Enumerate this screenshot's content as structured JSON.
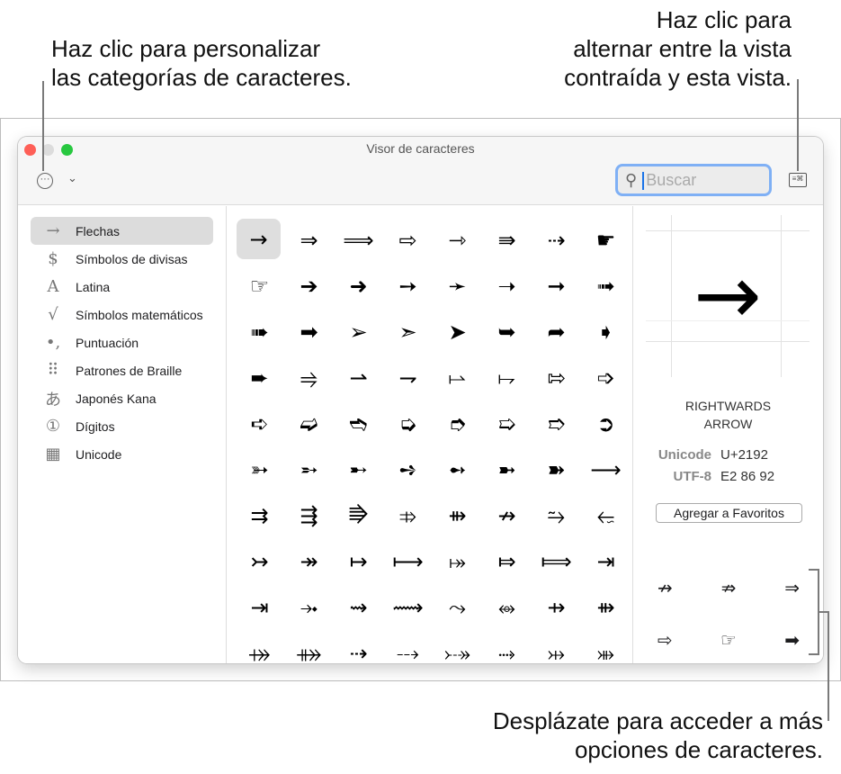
{
  "callouts": {
    "top_left": [
      "Haz clic para personalizar",
      "las categorías de caracteres."
    ],
    "top_right": [
      "Haz clic para",
      "alternar entre la vista",
      "contraída y esta vista."
    ],
    "bottom": [
      "Desplázate para acceder a más",
      "opciones de caracteres."
    ]
  },
  "window": {
    "title": "Visor de caracteres",
    "search_placeholder": "Buscar"
  },
  "sidebar": {
    "items": [
      {
        "icon": "→",
        "label": "Flechas"
      },
      {
        "icon": "$",
        "label": "Símbolos de divisas"
      },
      {
        "icon": "A",
        "label": "Latina"
      },
      {
        "icon": "√",
        "label": "Símbolos matemáticos"
      },
      {
        "icon": "•,",
        "label": "Puntuación"
      },
      {
        "icon": "⠿",
        "label": "Patrones de Braille"
      },
      {
        "icon": "あ",
        "label": "Japonés Kana"
      },
      {
        "icon": "①",
        "label": "Dígitos"
      },
      {
        "icon": "▦",
        "label": "Unicode"
      }
    ]
  },
  "glyphs": [
    "→",
    "⇒",
    "⟹",
    "⇨",
    "⇾",
    "⇛",
    "⇢",
    "☛",
    "☞",
    "➔",
    "➜",
    "➙",
    "➛",
    "➝",
    "➞",
    "➟",
    "➠",
    "➡",
    "➢",
    "➣",
    "➤",
    "➥",
    "➦",
    "➧",
    "➨",
    "⥤",
    "⇀",
    "⇁",
    "⥛",
    "⥟",
    "⇰",
    "➩",
    "➪",
    "➫",
    "➬",
    "➭",
    "➮",
    "➯",
    "➱",
    "➲",
    "➳",
    "➵",
    "➸",
    "➺",
    "➻",
    "➼",
    "➽",
    "⟶",
    "⇉",
    "⇶",
    "⭆",
    "⤃",
    "⇻",
    "↛",
    "⥲",
    "⭋",
    "↣",
    "↠",
    "↦",
    "⟼",
    "⤅",
    "⤇",
    "⟾",
    "⇥",
    "⇥",
    "⤞",
    "⇝",
    "⟿",
    "⤳",
    "⥈",
    "⇸",
    "⇻",
    "⤀",
    "⤁",
    "⇢",
    "⤏",
    "⤐",
    "⤑",
    "⤔",
    "⤕"
  ],
  "detail": {
    "glyph": "→",
    "name": [
      "RIGHTWARDS",
      "ARROW"
    ],
    "unicode_label": "Unicode",
    "unicode_value": "U+2192",
    "utf8_label": "UTF-8",
    "utf8_value": "E2 86 92",
    "add_favorite": "Agregar a Favoritos"
  },
  "favorites": [
    "↛",
    "⇏",
    "⇒",
    "⇨",
    "☞",
    "➡"
  ]
}
